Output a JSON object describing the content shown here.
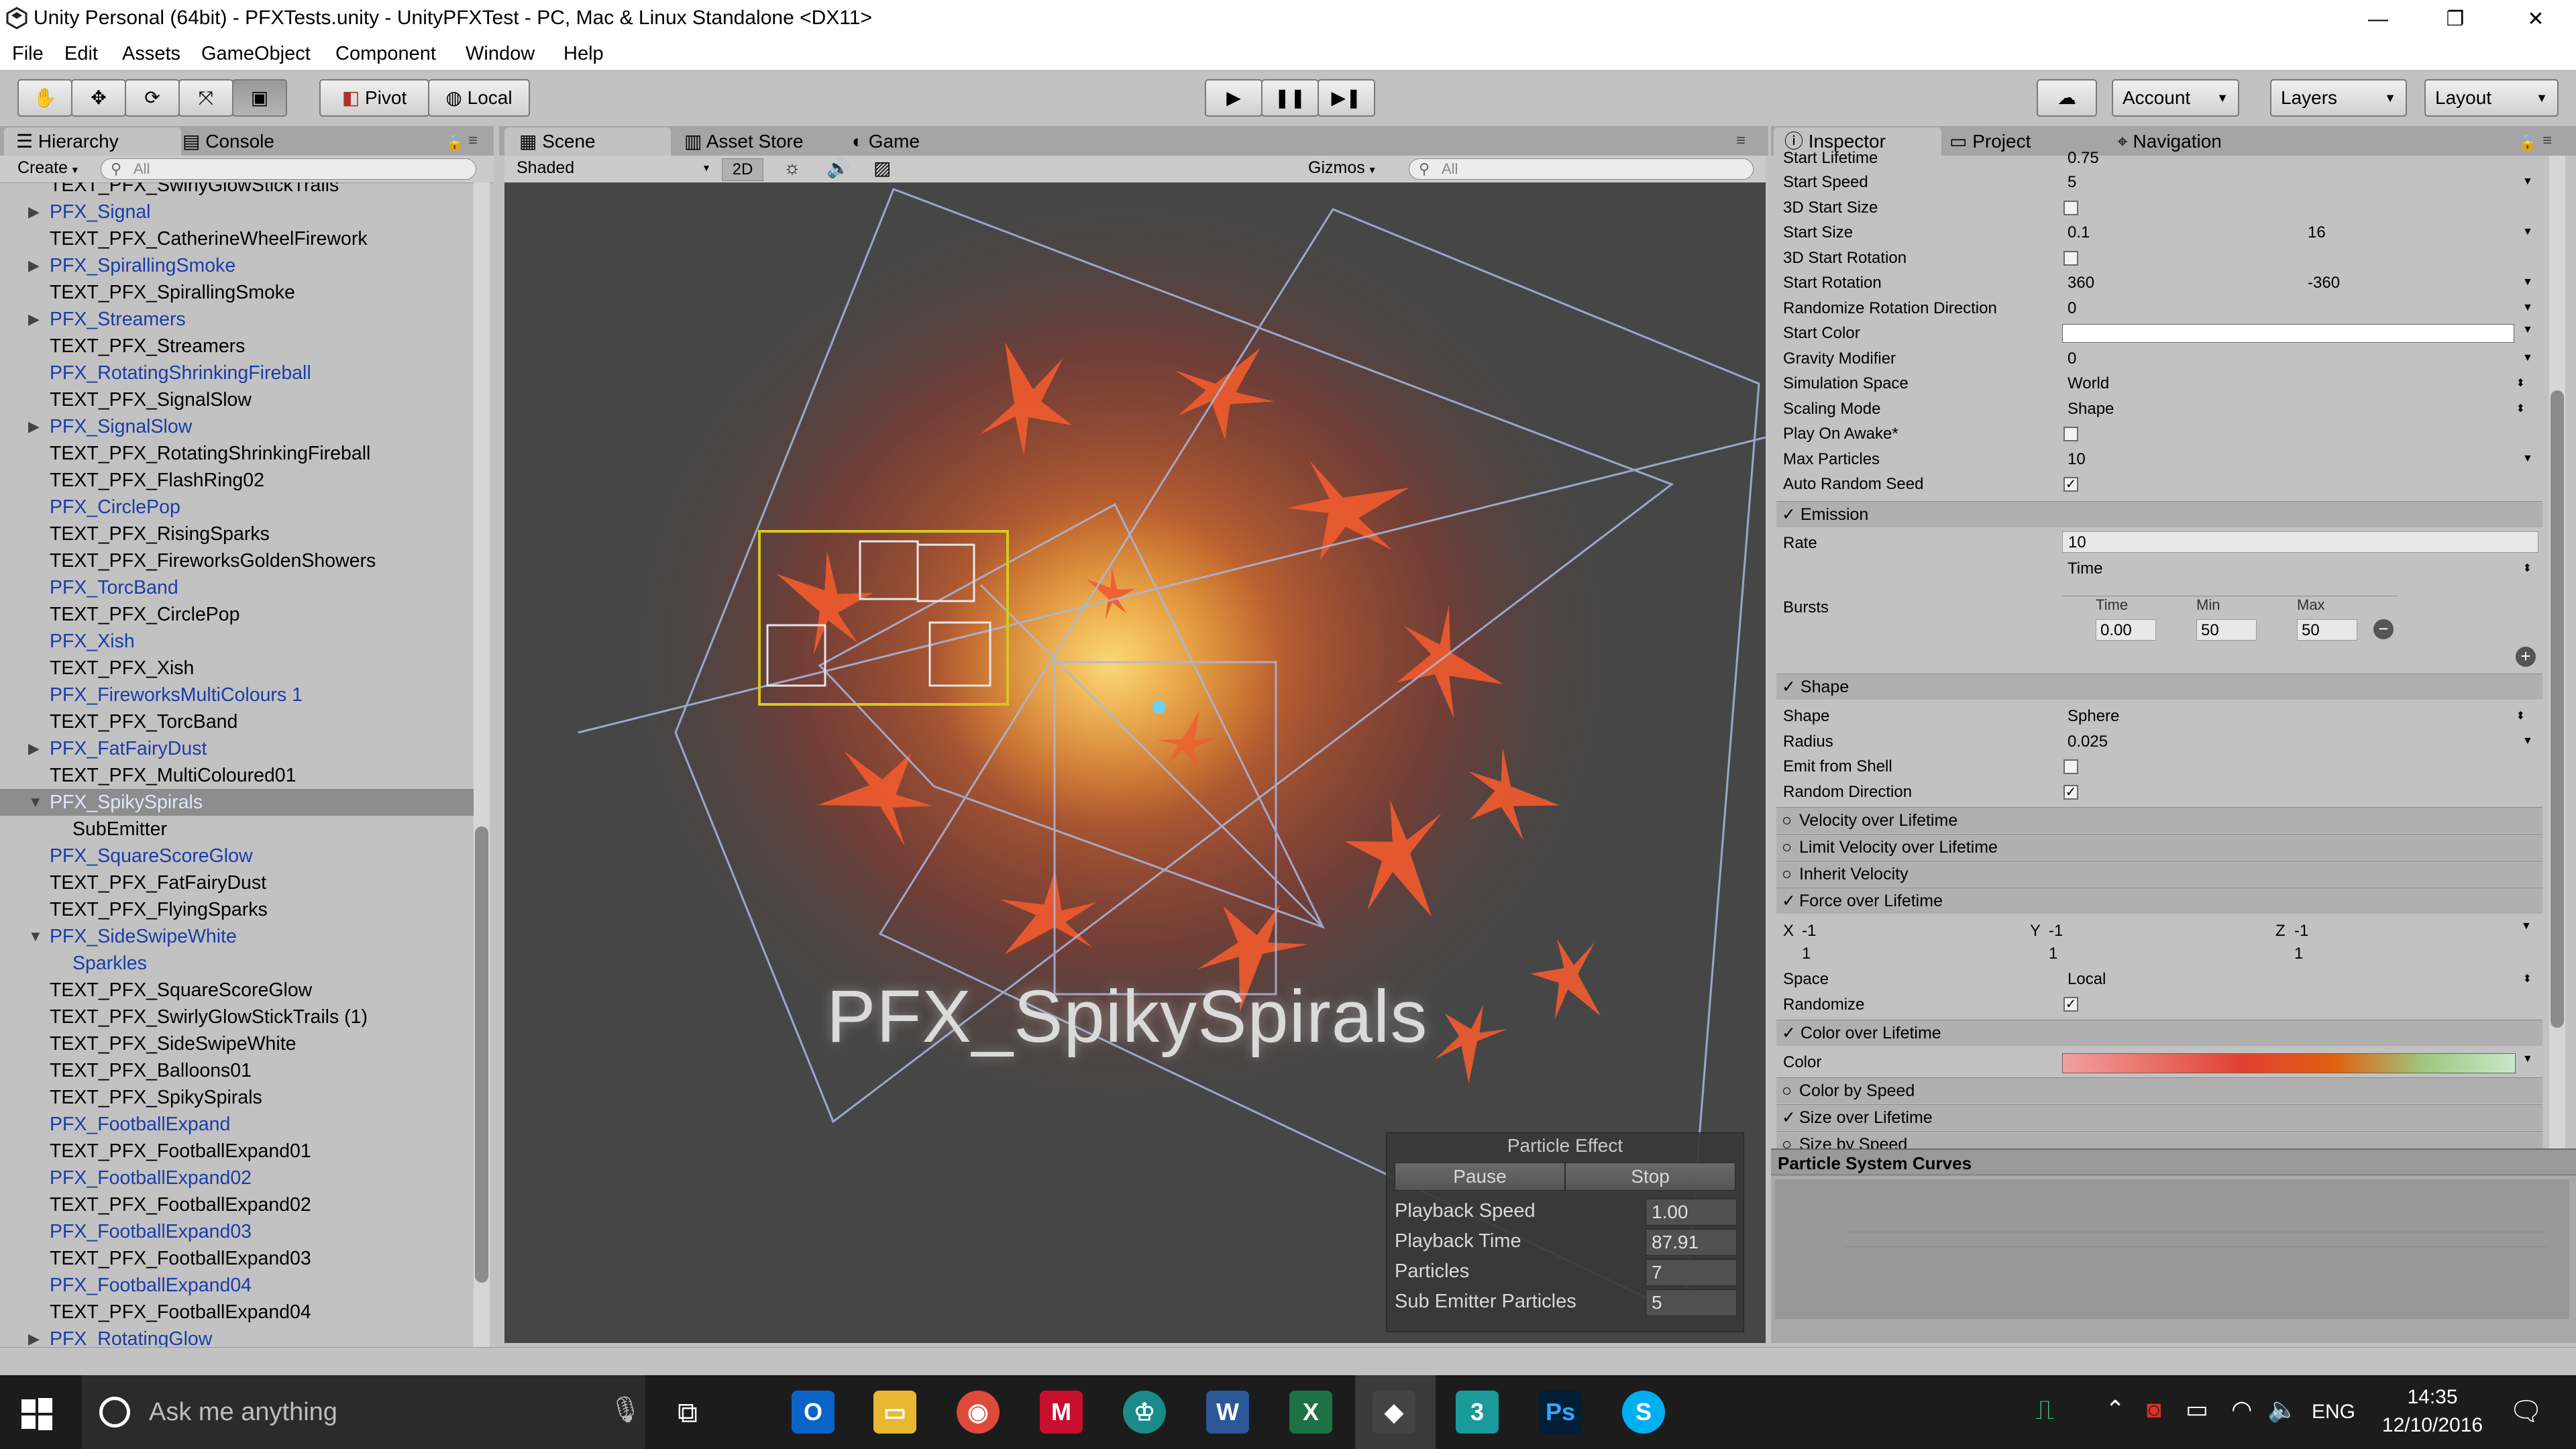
{
  "window": {
    "title": "Unity Personal (64bit) - PFXTests.unity - UnityPFXTest - PC, Mac & Linux Standalone <DX11>",
    "controls": [
      "—",
      "❐",
      "✕"
    ]
  },
  "menu": [
    "File",
    "Edit",
    "Assets",
    "GameObject",
    "Component",
    "Window",
    "Help"
  ],
  "toolbar": {
    "pivot": "Pivot",
    "local": "Local",
    "account": "Account",
    "layers": "Layers",
    "layout": "Layout"
  },
  "hierarchy": {
    "tab": "Hierarchy",
    "console_tab": "Console",
    "create": "Create",
    "search_placeholder": "All",
    "cut_top": "TEXT_PFX_SwirlyGlowStickTrails",
    "items": [
      {
        "label": "PFX_Signal",
        "prefab": true,
        "arrow": "▶"
      },
      {
        "label": "TEXT_PFX_CatherineWheelFirework",
        "prefab": false,
        "arrow": ""
      },
      {
        "label": "PFX_SpirallingSmoke",
        "prefab": true,
        "arrow": "▶"
      },
      {
        "label": "TEXT_PFX_SpirallingSmoke",
        "prefab": false,
        "arrow": ""
      },
      {
        "label": "PFX_Streamers",
        "prefab": true,
        "arrow": "▶"
      },
      {
        "label": "TEXT_PFX_Streamers",
        "prefab": false,
        "arrow": ""
      },
      {
        "label": "PFX_RotatingShrinkingFireball",
        "prefab": true,
        "arrow": ""
      },
      {
        "label": "TEXT_PFX_SignalSlow",
        "prefab": false,
        "arrow": ""
      },
      {
        "label": "PFX_SignalSlow",
        "prefab": true,
        "arrow": "▶"
      },
      {
        "label": "TEXT_PFX_RotatingShrinkingFireball",
        "prefab": false,
        "arrow": ""
      },
      {
        "label": "TEXT_PFX_FlashRing02",
        "prefab": false,
        "arrow": ""
      },
      {
        "label": "PFX_CirclePop",
        "prefab": true,
        "arrow": ""
      },
      {
        "label": "TEXT_PFX_RisingSparks",
        "prefab": false,
        "arrow": ""
      },
      {
        "label": "TEXT_PFX_FireworksGoldenShowers",
        "prefab": false,
        "arrow": ""
      },
      {
        "label": "PFX_TorcBand",
        "prefab": true,
        "arrow": ""
      },
      {
        "label": "TEXT_PFX_CirclePop",
        "prefab": false,
        "arrow": ""
      },
      {
        "label": "PFX_Xish",
        "prefab": true,
        "arrow": ""
      },
      {
        "label": "TEXT_PFX_Xish",
        "prefab": false,
        "arrow": ""
      },
      {
        "label": "PFX_FireworksMultiColours 1",
        "prefab": true,
        "arrow": ""
      },
      {
        "label": "TEXT_PFX_TorcBand",
        "prefab": false,
        "arrow": ""
      },
      {
        "label": "PFX_FatFairyDust",
        "prefab": true,
        "arrow": "▶"
      },
      {
        "label": "TEXT_PFX_MultiColoured01",
        "prefab": false,
        "arrow": ""
      },
      {
        "label": "PFX_SpikySpirals",
        "prefab": true,
        "arrow": "▼",
        "selected": true
      },
      {
        "label": "SubEmitter",
        "prefab": false,
        "arrow": "",
        "indent": true
      },
      {
        "label": "PFX_SquareScoreGlow",
        "prefab": true,
        "arrow": ""
      },
      {
        "label": "TEXT_PFX_FatFairyDust",
        "prefab": false,
        "arrow": ""
      },
      {
        "label": "TEXT_PFX_FlyingSparks",
        "prefab": false,
        "arrow": ""
      },
      {
        "label": "PFX_SideSwipeWhite",
        "prefab": true,
        "arrow": "▼"
      },
      {
        "label": "Sparkles",
        "prefab": true,
        "arrow": "",
        "indent": true
      },
      {
        "label": "TEXT_PFX_SquareScoreGlow",
        "prefab": false,
        "arrow": ""
      },
      {
        "label": "TEXT_PFX_SwirlyGlowStickTrails (1)",
        "prefab": false,
        "arrow": ""
      },
      {
        "label": "TEXT_PFX_SideSwipeWhite",
        "prefab": false,
        "arrow": ""
      },
      {
        "label": "TEXT_PFX_Balloons01",
        "prefab": false,
        "arrow": ""
      },
      {
        "label": "TEXT_PFX_SpikySpirals",
        "prefab": false,
        "arrow": ""
      },
      {
        "label": "PFX_FootballExpand",
        "prefab": true,
        "arrow": ""
      },
      {
        "label": "TEXT_PFX_FootballExpand01",
        "prefab": false,
        "arrow": ""
      },
      {
        "label": "PFX_FootballExpand02",
        "prefab": true,
        "arrow": ""
      },
      {
        "label": "TEXT_PFX_FootballExpand02",
        "prefab": false,
        "arrow": ""
      },
      {
        "label": "PFX_FootballExpand03",
        "prefab": true,
        "arrow": ""
      },
      {
        "label": "TEXT_PFX_FootballExpand03",
        "prefab": false,
        "arrow": ""
      },
      {
        "label": "PFX_FootballExpand04",
        "prefab": true,
        "arrow": ""
      },
      {
        "label": "TEXT_PFX_FootballExpand04",
        "prefab": false,
        "arrow": ""
      },
      {
        "label": "PFX_RotatingGlow",
        "prefab": true,
        "arrow": "▶"
      }
    ]
  },
  "scene": {
    "tabs": [
      "Scene",
      "Asset Store",
      "Game"
    ],
    "shading": "Shaded",
    "mode2d": "2D",
    "gizmos": "Gizmos",
    "search_placeholder": "All",
    "label": "PFX_SpikySpirals"
  },
  "particle_effect": {
    "title": "Particle Effect",
    "pause": "Pause",
    "stop": "Stop",
    "rows": [
      {
        "label": "Playback Speed",
        "value": "1.00"
      },
      {
        "label": "Playback Time",
        "value": "87.91"
      },
      {
        "label": "Particles",
        "value": "7"
      },
      {
        "label": "Sub Emitter Particles",
        "value": "5"
      }
    ]
  },
  "inspector": {
    "tabs": [
      "Inspector",
      "Project",
      "Navigation"
    ],
    "cut_top": {
      "label": "Start Lifetime",
      "value": "0.75"
    },
    "props": [
      {
        "label": "Start Speed",
        "value": "5",
        "value2": "",
        "type": "field"
      },
      {
        "label": "3D Start Size",
        "value": "",
        "value2": "",
        "type": "check",
        "checked": false
      },
      {
        "label": "Start Size",
        "value": "0.1",
        "value2": "16",
        "type": "field"
      },
      {
        "label": "3D Start Rotation",
        "value": "",
        "value2": "",
        "type": "check",
        "checked": false
      },
      {
        "label": "Start Rotation",
        "value": "360",
        "value2": "-360",
        "type": "field"
      },
      {
        "label": "Randomize Rotation Direction",
        "value": "0",
        "value2": "",
        "type": "field"
      },
      {
        "label": "Start Color",
        "value": "",
        "value2": "",
        "type": "color"
      },
      {
        "label": "Gravity Modifier",
        "value": "0",
        "value2": "",
        "type": "field"
      },
      {
        "label": "Simulation Space",
        "value": "World",
        "value2": "",
        "type": "dropdown"
      },
      {
        "label": "Scaling Mode",
        "value": "Shape",
        "value2": "",
        "type": "dropdown"
      },
      {
        "label": "Play On Awake*",
        "value": "",
        "value2": "",
        "type": "check",
        "checked": false
      },
      {
        "label": "Max Particles",
        "value": "10",
        "value2": "",
        "type": "field"
      },
      {
        "label": "Auto Random Seed",
        "value": "",
        "value2": "",
        "type": "check",
        "checked": true
      }
    ],
    "emission": {
      "header": "Emission",
      "rate_label": "Rate",
      "rate_value": "10",
      "rate_mode": "Time",
      "bursts_label": "Bursts",
      "burst_headers": [
        "Time",
        "Min",
        "Max"
      ],
      "burst_values": [
        "0.00",
        "50",
        "50"
      ]
    },
    "shape": {
      "header": "Shape",
      "props": [
        {
          "label": "Shape",
          "value": "Sphere",
          "type": "dropdown"
        },
        {
          "label": "Radius",
          "value": "0.025",
          "type": "field"
        },
        {
          "label": "Emit from Shell",
          "value": "",
          "type": "check",
          "checked": false
        },
        {
          "label": "Random Direction",
          "value": "",
          "type": "check",
          "checked": true
        }
      ]
    },
    "modules_mid": [
      {
        "label": "Velocity over Lifetime",
        "checked": false
      },
      {
        "label": "Limit Velocity over Lifetime",
        "checked": false
      },
      {
        "label": "Inherit Velocity",
        "checked": false
      },
      {
        "label": "Force over Lifetime",
        "checked": true
      }
    ],
    "force": {
      "x_label": "X",
      "x_a": "-1",
      "x_b": "1",
      "y_label": "Y",
      "y_a": "-1",
      "y_b": "1",
      "z_label": "Z",
      "z_a": "-1",
      "z_b": "1",
      "space_label": "Space",
      "space_value": "Local",
      "randomize_label": "Randomize"
    },
    "color_over_lifetime": {
      "header": "Color over Lifetime",
      "color_label": "Color"
    },
    "modules_bottom": [
      {
        "label": "Color by Speed",
        "checked": false
      },
      {
        "label": "Size over Lifetime",
        "checked": true
      },
      {
        "label": "Size by Speed",
        "checked": false
      }
    ],
    "curves_title": "Particle System Curves"
  },
  "taskbar": {
    "search_placeholder": "Ask me anything",
    "lang": "ENG",
    "time": "14:35",
    "date": "12/10/2016",
    "apps": [
      "outlook-icon",
      "file-explorer-icon",
      "chrome-icon",
      "mcafee-icon",
      "app-icon",
      "word-icon",
      "excel-icon",
      "unity-icon",
      "3dsmax-icon",
      "photoshop-icon",
      "skype-icon"
    ]
  },
  "colors": {
    "prefab_text": "#1b3da8",
    "selection_bg": "#8d8d8d",
    "scene_bg": "#464646",
    "gizmo_yellow": "#d6c81e",
    "gizmo_blue": "#a8b8e0"
  }
}
